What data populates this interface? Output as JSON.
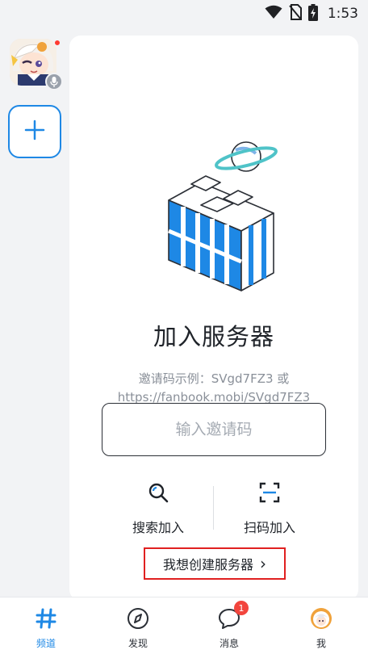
{
  "status_bar": {
    "time": "1:53"
  },
  "main": {
    "title": "加入服务器",
    "hint_line1": "邀请码示例：SVgd7FZ3 或",
    "hint_line2": "https://fanbook.mobi/SVgd7FZ3",
    "invite_placeholder": "输入邀请码",
    "invite_value": "",
    "search_join_label": "搜索加入",
    "scan_join_label": "扫码加入",
    "create_server_label": "我想创建服务器",
    "create_server_chevron": "›"
  },
  "bottom_nav": {
    "items": [
      {
        "label": "频道",
        "icon": "hashtag-icon",
        "active": true
      },
      {
        "label": "发现",
        "icon": "compass-icon",
        "active": false
      },
      {
        "label": "消息",
        "icon": "chat-bubble-icon",
        "active": false,
        "badge": "1"
      },
      {
        "label": "我",
        "icon": "avatar-icon",
        "active": false
      }
    ]
  },
  "colors": {
    "accent": "#1e88e5",
    "highlight_border": "#e02020",
    "badge": "#f2453d",
    "background": "#f2f3f5"
  }
}
